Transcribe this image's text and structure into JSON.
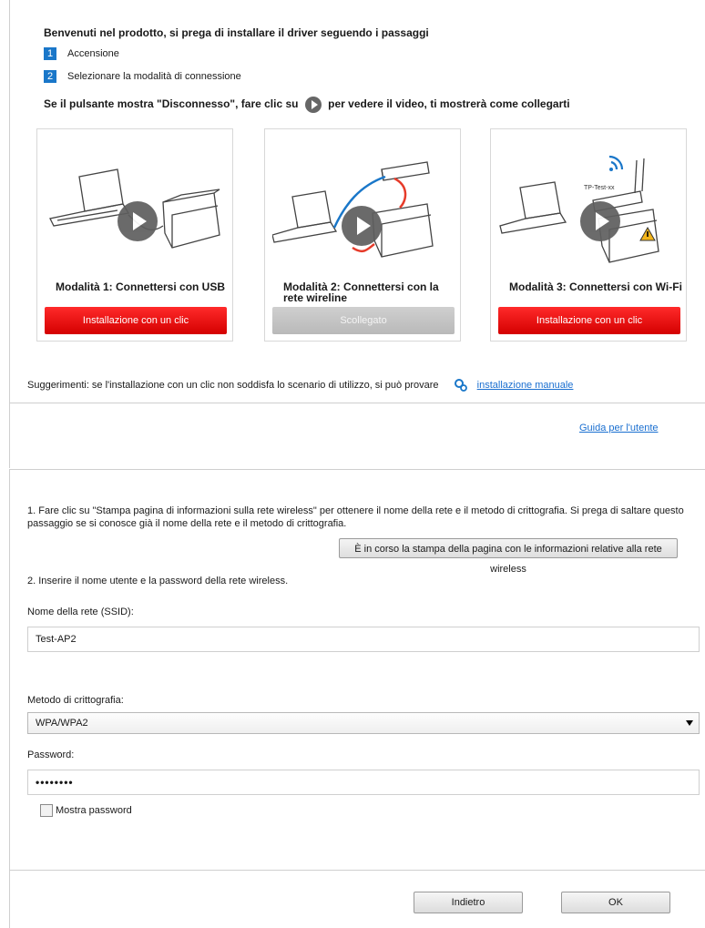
{
  "header": {
    "welcome": "Benvenuti nel prodotto, si prega di installare il driver seguendo i passaggi",
    "steps": [
      {
        "num": "1",
        "label": "Accensione"
      },
      {
        "num": "2",
        "label": "Selezionare la modalità di connessione"
      }
    ],
    "hint_before": "Se il pulsante mostra \"Disconnesso\", fare clic su",
    "hint_after": "per vedere il video, ti mostrerà come collegarti"
  },
  "modes": [
    {
      "title": "Modalità 1: Connettersi con USB",
      "button": "Installazione con un clic",
      "button_state": "enabled",
      "button_color": "#e60012"
    },
    {
      "title": "Modalità 2: Connettersi con la rete wireline",
      "button": "Scollegato",
      "button_state": "disabled",
      "button_color": "#c4c4c4"
    },
    {
      "title": "Modalità 3: Connettersi con Wi-Fi",
      "button": "Installazione con un clic",
      "button_state": "enabled",
      "button_color": "#e60012"
    }
  ],
  "wifi_illustration_label": "TP-Test-xx",
  "suggestion": {
    "text": "Suggerimenti: se l'installazione con un clic non soddisfa lo scenario di utilizzo, si può provare",
    "link": "installazione manuale"
  },
  "guide_link": "Guida per l'utente",
  "wireless": {
    "step1": "1. Fare clic su \"Stampa pagina di informazioni sulla rete wireless\" per ottenere il nome della rete e il metodo di crittografia. Si prega di saltare questo passaggio se si conosce già il nome della rete e il metodo di crittografia.",
    "print_button": "È in corso la stampa della pagina con le informazioni relative alla rete wireless",
    "step2": "2. Inserire il nome utente e la password della rete wireless.",
    "ssid_label": "Nome della rete (SSID):",
    "ssid_value": "Test-AP2",
    "encryption_label": "Metodo di crittografia:",
    "encryption_value": "WPA/WPA2",
    "password_label": "Password:",
    "password_value": "••••••••",
    "show_password_label": "Mostra password",
    "show_password_checked": false
  },
  "footer": {
    "back_button": "Indietro",
    "ok_button": "OK"
  },
  "colors": {
    "accent_blue": "#1a77c9",
    "link_blue": "#1a6fd0",
    "install_red": "#e60012"
  }
}
